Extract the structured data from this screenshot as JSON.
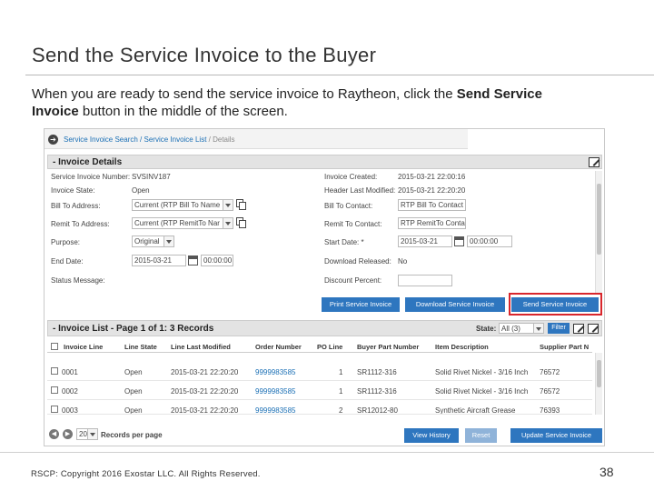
{
  "slide": {
    "title": "Send the Service Invoice to the Buyer",
    "intro_1": "When you are ready to send the service invoice to Raytheon, click the ",
    "intro_bold_1": "Send Service",
    "intro_newline_bold": "Invoice",
    "intro_2": " button in the middle of the screen.",
    "footer": "RSCP: Copyright 2016 Exostar LLC. All Rights Reserved.",
    "page_number": "38"
  },
  "breadcrumb": {
    "item_1": "Service Invoice Search",
    "sep": " / ",
    "item_2": "Service Invoice List",
    "item_3": "Details"
  },
  "details": {
    "header": "- Invoice Details",
    "left": {
      "number_label": "Service Invoice Number:",
      "number_value": "SVSINV187",
      "state_label": "Invoice State:",
      "state_value": "Open",
      "bill_to_label": "Bill To Address:",
      "bill_to_value": "Current (RTP Bill To Name",
      "remit_to_label": "Remit To Address:",
      "remit_to_value": "Current (RTP RemitTo Nar",
      "purpose_label": "Purpose:",
      "purpose_value": "Original",
      "end_date_label": "End Date:",
      "end_date_value": "2015-03-21",
      "end_time_value": "00:00:00",
      "status_msg_label": "Status Message:"
    },
    "right": {
      "created_label": "Invoice Created:",
      "created_value": "2015-03-21 22:00:16",
      "modified_label": "Header Last Modified:",
      "modified_value": "2015-03-21 22:20:20",
      "bill_contact_label": "Bill To Contact:",
      "bill_contact_value": "RTP Bill To Contact",
      "remit_contact_label": "Remit To Contact:",
      "remit_contact_value": "RTP RemitTo Conta",
      "start_date_label": "Start Date: *",
      "start_date_value": "2015-03-21",
      "start_time_value": "00:00:00",
      "download_label": "Download Released:",
      "download_value": "No",
      "discount_label": "Discount Percent:"
    },
    "buttons": {
      "print": "Print Service Invoice",
      "download": "Download Service Invoice",
      "send": "Send Service Invoice"
    }
  },
  "list": {
    "header": "- Invoice List - Page 1 of 1: 3 Records",
    "state_label": "State:",
    "state_value": "All (3)",
    "filter_label": "Filter",
    "columns": [
      "Invoice Line",
      "Line State",
      "Line Last Modified",
      "Order Number",
      "PO Line",
      "Buyer Part Number",
      "Item Description",
      "Supplier Part N"
    ],
    "rows": [
      {
        "line": "0001",
        "state": "Open",
        "modified": "2015-03-21 22:20:20",
        "order": "9999983585",
        "po_line": "1",
        "buyer_part": "SR1112-316",
        "desc": "Solid Rivet Nickel - 3/16 Inch",
        "supplier_part": "76572"
      },
      {
        "line": "0002",
        "state": "Open",
        "modified": "2015-03-21 22:20:20",
        "order": "9999983585",
        "po_line": "1",
        "buyer_part": "SR1112-316",
        "desc": "Solid Rivet Nickel - 3/16 Inch",
        "supplier_part": "76572"
      },
      {
        "line": "0003",
        "state": "Open",
        "modified": "2015-03-21 22:20:20",
        "order": "9999983585",
        "po_line": "2",
        "buyer_part": "SR12012-80",
        "desc": "Synthetic Aircraft Grease",
        "supplier_part": "76393"
      }
    ]
  },
  "pager": {
    "per_page_value": "20",
    "per_page_label": "Records per page",
    "view_history": "View History",
    "reset": "Reset",
    "update": "Update Service Invoice"
  },
  "colors": {
    "button_blue": "#2e76bf",
    "highlight_red": "#d9262c",
    "link_blue": "#1a6fb5"
  }
}
